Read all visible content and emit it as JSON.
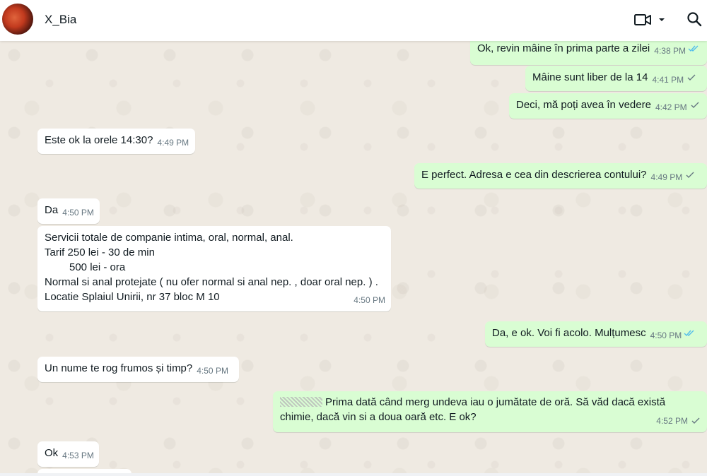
{
  "header": {
    "contact_name": "X_Bia",
    "icons": [
      "avatar",
      "video-call-icon",
      "chevron-down-icon",
      "search-icon"
    ]
  },
  "colors": {
    "incoming_bubble": "#ffffff",
    "outgoing_bubble": "#d9fdd3",
    "chat_background": "#efeae2",
    "read_tick": "#53bdeb",
    "sent_tick": "#667781"
  },
  "messages": [
    {
      "dir": "out",
      "text": "Ok, revin mâine în prima parte a zilei",
      "time": "4:38 PM",
      "status": "read"
    },
    {
      "dir": "out",
      "text": "Mâine sunt liber de la 14",
      "time": "4:41 PM",
      "status": "sent"
    },
    {
      "dir": "out",
      "text": "Deci, mă poți avea în vedere",
      "time": "4:42 PM",
      "status": "sent"
    },
    {
      "dir": "in",
      "text": "Este ok la orele 14:30?",
      "time": "4:49 PM"
    },
    {
      "dir": "out",
      "text": "E perfect. Adresa e cea din descrierea contului?",
      "time": "4:49 PM",
      "status": "sent"
    },
    {
      "dir": "in",
      "text": "Da",
      "time": "4:50 PM"
    },
    {
      "dir": "in",
      "lines": [
        "Servicii totale de companie intima, oral, normal, anal.",
        "Tarif 250 lei - 30 de min",
        "500 lei - ora",
        "Normal si anal protejate ( nu ofer normal si anal nep. , doar oral nep. ) .",
        "Locatie Splaiul Unirii, nr 37 bloc M 10"
      ],
      "time": "4:50 PM"
    },
    {
      "dir": "out",
      "text": "Da, e ok. Voi fi acolo. Mulțumesc",
      "time": "4:50 PM",
      "status": "read"
    },
    {
      "dir": "in",
      "text": "Un nume te rog frumos și timp?",
      "time": "4:50 PM"
    },
    {
      "dir": "out",
      "lines": [
        "Prima dată când merg undeva iau o jumătate de oră. Să văd dacă există",
        "chimie, dacă vin si a doua oară etc. E ok?"
      ],
      "time": "4:52 PM",
      "status": "sent"
    },
    {
      "dir": "in",
      "text": "Ok",
      "time": "4:53 PM"
    }
  ]
}
